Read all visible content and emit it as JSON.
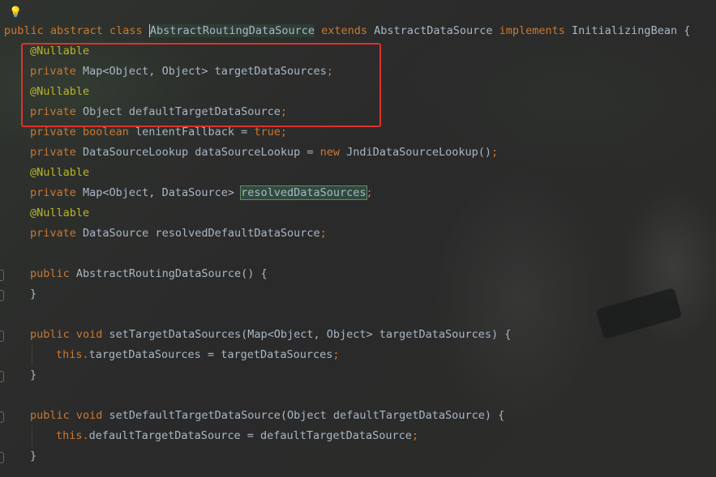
{
  "editor": {
    "lines": [
      {
        "tokens": [
          {
            "t": "kw",
            "v": "public abstract class "
          },
          {
            "t": "cursor",
            "v": "AbstractRoutingDataSource"
          },
          {
            "t": "kw",
            "v": " extends "
          },
          {
            "t": "plain",
            "v": "AbstractDataSource"
          },
          {
            "t": "kw",
            "v": " implements "
          },
          {
            "t": "plain",
            "v": "InitializingBean {"
          }
        ]
      },
      {
        "indent": 1,
        "tokens": [
          {
            "t": "ann",
            "v": "@Nullable"
          }
        ]
      },
      {
        "indent": 1,
        "tokens": [
          {
            "t": "kw",
            "v": "private "
          },
          {
            "t": "plain",
            "v": "Map<Object, Object> targetDataSources"
          },
          {
            "t": "kw",
            "v": ";"
          }
        ]
      },
      {
        "indent": 1,
        "tokens": [
          {
            "t": "ann",
            "v": "@Nullable"
          }
        ]
      },
      {
        "indent": 1,
        "tokens": [
          {
            "t": "kw",
            "v": "private "
          },
          {
            "t": "plain",
            "v": "Object defaultTargetDataSource"
          },
          {
            "t": "kw",
            "v": ";"
          }
        ]
      },
      {
        "indent": 1,
        "tokens": [
          {
            "t": "kw",
            "v": "private boolean "
          },
          {
            "t": "plain",
            "v": "lenientFallback = "
          },
          {
            "t": "kw",
            "v": "true;"
          }
        ]
      },
      {
        "indent": 1,
        "tokens": [
          {
            "t": "kw",
            "v": "private "
          },
          {
            "t": "plain",
            "v": "DataSourceLookup dataSourceLookup = "
          },
          {
            "t": "kw",
            "v": "new "
          },
          {
            "t": "plain",
            "v": "JndiDataSourceLookup()"
          },
          {
            "t": "kw",
            "v": ";"
          }
        ]
      },
      {
        "indent": 1,
        "tokens": [
          {
            "t": "ann",
            "v": "@Nullable"
          }
        ]
      },
      {
        "indent": 1,
        "tokens": [
          {
            "t": "kw",
            "v": "private "
          },
          {
            "t": "plain",
            "v": "Map<Object, DataSource> "
          },
          {
            "t": "highlight",
            "v": "resolvedDataSources"
          },
          {
            "t": "kw",
            "v": ";"
          }
        ]
      },
      {
        "indent": 1,
        "tokens": [
          {
            "t": "ann",
            "v": "@Nullable"
          }
        ]
      },
      {
        "indent": 1,
        "tokens": [
          {
            "t": "kw",
            "v": "private "
          },
          {
            "t": "plain",
            "v": "DataSource resolvedDefaultDataSource"
          },
          {
            "t": "kw",
            "v": ";"
          }
        ]
      },
      {
        "tokens": []
      },
      {
        "indent": 1,
        "fold": true,
        "tokens": [
          {
            "t": "kw",
            "v": "public "
          },
          {
            "t": "plain",
            "v": "AbstractRoutingDataSource() {"
          }
        ]
      },
      {
        "indent": 1,
        "fold": true,
        "tokens": [
          {
            "t": "plain",
            "v": "}"
          }
        ]
      },
      {
        "tokens": []
      },
      {
        "indent": 1,
        "fold": true,
        "tokens": [
          {
            "t": "kw",
            "v": "public void "
          },
          {
            "t": "plain",
            "v": "setTargetDataSources(Map<Object, Object> targetDataSources) {"
          }
        ]
      },
      {
        "indent": 2,
        "tokens": [
          {
            "t": "kw",
            "v": "this."
          },
          {
            "t": "plain",
            "v": "targetDataSources = targetDataSources"
          },
          {
            "t": "kw",
            "v": ";"
          }
        ]
      },
      {
        "indent": 1,
        "fold": true,
        "tokens": [
          {
            "t": "plain",
            "v": "}"
          }
        ]
      },
      {
        "tokens": []
      },
      {
        "indent": 1,
        "fold": true,
        "tokens": [
          {
            "t": "kw",
            "v": "public void "
          },
          {
            "t": "plain",
            "v": "setDefaultTargetDataSource(Object defaultTargetDataSource) {"
          }
        ]
      },
      {
        "indent": 2,
        "tokens": [
          {
            "t": "kw",
            "v": "this."
          },
          {
            "t": "plain",
            "v": "defaultTargetDataSource = defaultTargetDataSource"
          },
          {
            "t": "kw",
            "v": ";"
          }
        ]
      },
      {
        "indent": 1,
        "fold": true,
        "tokens": [
          {
            "t": "plain",
            "v": "}"
          }
        ]
      }
    ]
  },
  "colors": {
    "keyword": "#cc7832",
    "annotation": "#bbb529",
    "text": "#a9b7c6",
    "annotation_box": "#e0312b",
    "background": "#2b2b2b"
  },
  "icons": {
    "intention": "lightbulb-icon"
  }
}
